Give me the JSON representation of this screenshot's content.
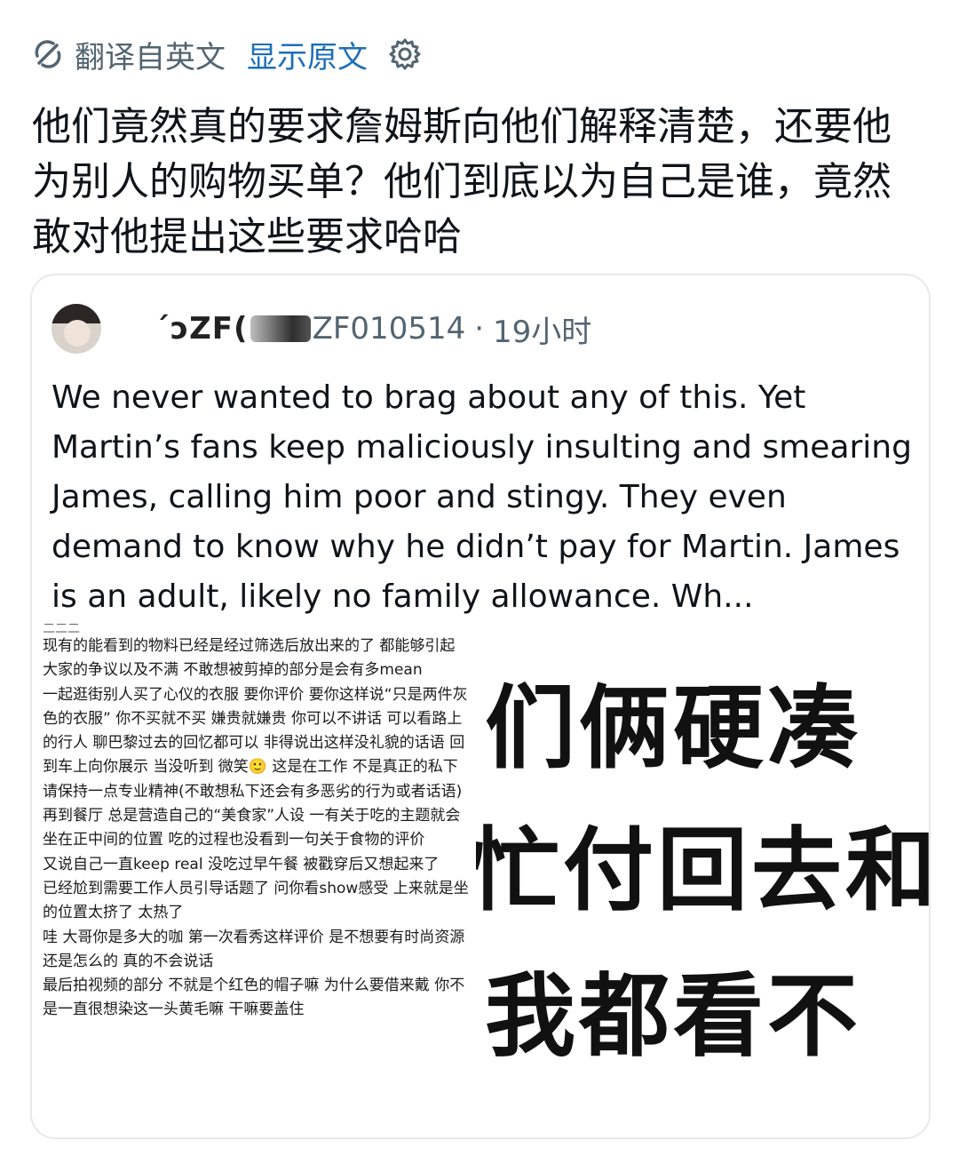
{
  "translate_bar": {
    "label": "翻译自英文",
    "show_original": "显示原文",
    "icons": [
      "translate-icon",
      "gear-icon"
    ]
  },
  "post": {
    "text": "他们竟然真的要求詹姆斯向他们解释清楚，还要他为别人的购物买单？他们到底以为自己是谁，竟然敢对他提出这些要求哈哈"
  },
  "quote": {
    "handle_visible_start": "´ɔZF(",
    "handle_visible_end": "ZF010514",
    "separator": "·",
    "time": "19小时",
    "text": "We never wanted to brag about any of this. Yet Martin’s fans keep maliciously insulting and smearing James, calling him poor and stingy. They even demand to know why he didn’t pay for Martin. James is an adult, likely no family allowance.  Wh..."
  },
  "image": {
    "truncated_top": "二二二",
    "paragraphs": [
      "现有的能看到的物料已经是经过筛选后放出来的了 都能够引起大家的争议以及不满 不敢想被剪掉的部分是会有多mean",
      "一起逛街别人买了心仪的衣服 要你评价 要你这样说“只是两件灰色的衣服” 你不买就不买 嫌贵就嫌贵 你可以不讲话 可以看路上的行人 聊巴黎过去的回忆都可以 非得说出这样没礼貌的话语 回到车上向你展示 当没听到 微笑🙂 这是在工作 不是真正的私下 请保持一点专业精神(不敢想私下还会有多恶劣的行为或者话语)",
      "再到餐厅 总是营造自己的“美食家”人设 一有关于吃的主题就会坐在正中间的位置 吃的过程也没看到一句关于食物的评价",
      "又说自己一直keep real 没吃过早午餐 被戳穿后又想起来了",
      "已经尬到需要工作人员引导话题了 问你看show感受 上来就是坐的位置太挤了 太热了",
      "哇 大哥你是多大的咖 第一次看秀这样评价 是不想要有时尚资源还是怎么的 真的不会说话",
      "最后拍视频的部分 不就是个红色的帽子嘛 为什么要借来戴 你不是一直很想染这一头黄毛嘛 干嘛要盖住"
    ],
    "big_lines": [
      "们俩硬凑",
      "忙付回去和",
      "我都看不"
    ]
  }
}
